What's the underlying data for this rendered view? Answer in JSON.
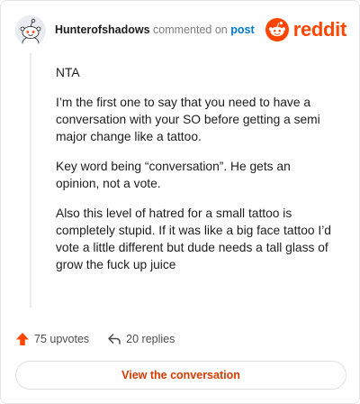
{
  "comment": {
    "username": "Hunterofshadows",
    "action_text": "commented on",
    "post_link_text": "post",
    "paragraphs": [
      "NTA",
      "I’m the first one to say that you need to have a conversation with your SO before getting a semi major change like a tattoo.",
      "Key word being “conversation”. He gets an opinion, not a vote.",
      "Also this level of hatred for a small tattoo is completely stupid. If it was like a big face tattoo I’d vote a little different but dude needs a tall glass of grow the fuck up juice"
    ]
  },
  "brand": {
    "name": "reddit",
    "color": "#ff4500",
    "icon": "reddit-logo-icon"
  },
  "footer": {
    "upvotes_label": "75 upvotes",
    "replies_label": "20 replies",
    "upvote_icon": "upvote-arrow-icon",
    "reply_icon": "reply-arrow-icon"
  },
  "cta": {
    "label": "View the conversation"
  },
  "colors": {
    "accent": "#ff4500",
    "link": "#0079d3",
    "cta_text": "#d93a00"
  }
}
